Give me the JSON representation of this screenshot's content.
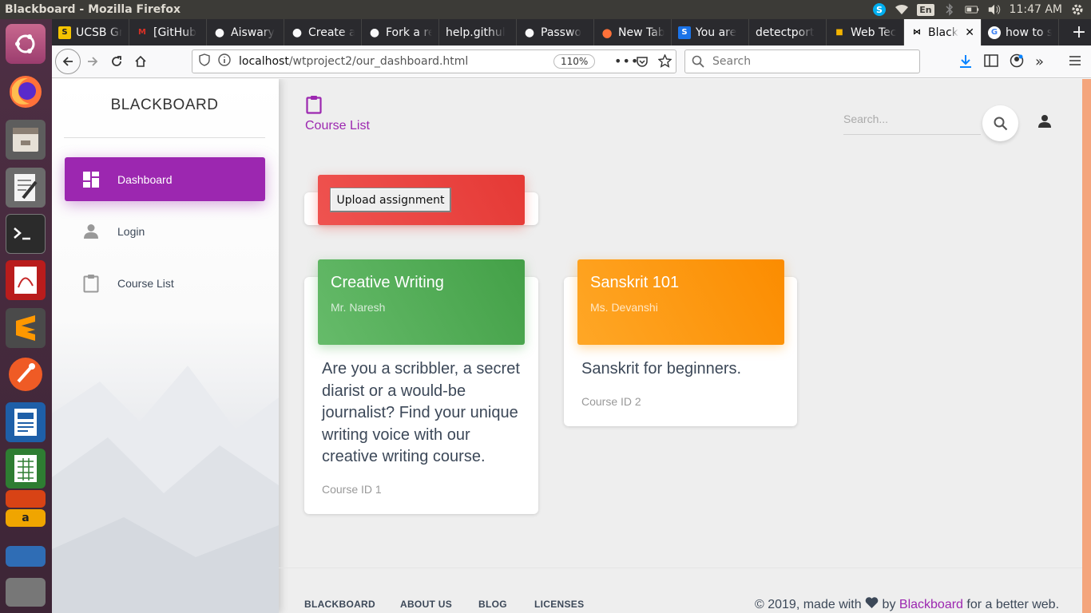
{
  "system": {
    "window_title": "Blackboard - Mozilla Firefox",
    "keyboard_layout": "En",
    "clock": "11:47 AM"
  },
  "launcher": {
    "items": [
      "ubuntu-dash",
      "firefox",
      "files",
      "text-editor",
      "terminal",
      "document-viewer",
      "sublime-text",
      "postman",
      "writer",
      "calc",
      "impress",
      "amazon",
      "system-monitor",
      "trash"
    ]
  },
  "browser": {
    "tabs": [
      {
        "label": "UCSB Gr",
        "icon": "ucsb-icon",
        "color": "#f5c400"
      },
      {
        "label": "[GitHub",
        "icon": "gmail-icon",
        "color": "#d93025"
      },
      {
        "label": "Aiswary",
        "icon": "github-icon",
        "color": "#ffffff"
      },
      {
        "label": "Create a",
        "icon": "github-icon",
        "color": "#ffffff"
      },
      {
        "label": "Fork a re",
        "icon": "github-icon",
        "color": "#ffffff"
      },
      {
        "label": "help.githul",
        "icon": "",
        "color": ""
      },
      {
        "label": "Passwo",
        "icon": "github-icon",
        "color": "#ffffff"
      },
      {
        "label": "New Tab",
        "icon": "firefox-icon",
        "color": "#ff7139"
      },
      {
        "label": "You are",
        "icon": "s-icon",
        "color": "#1a73e8"
      },
      {
        "label": "detectport",
        "icon": "",
        "color": ""
      },
      {
        "label": "Web Tec",
        "icon": "slides-icon",
        "color": "#f4b400"
      },
      {
        "label": "Black",
        "icon": "bow-icon",
        "color": "#000000",
        "active": true
      },
      {
        "label": "how to s",
        "icon": "google-icon",
        "color": "#4285f4"
      }
    ],
    "url_host": "localhost",
    "url_path": "/wtproject2/our_dashboard.html",
    "zoom": "110%",
    "search_placeholder": "Search"
  },
  "sidebar": {
    "brand": "BLACKBOARD",
    "items": [
      {
        "label": "Dashboard",
        "icon": "dashboard-icon",
        "active": true
      },
      {
        "label": "Login",
        "icon": "person-icon"
      },
      {
        "label": "Course List",
        "icon": "clipboard-icon"
      }
    ],
    "active_color": "#9c27b0"
  },
  "header": {
    "title": "Course List",
    "search_placeholder": "Search..."
  },
  "upload": {
    "button_label": "Upload assignment"
  },
  "courses": [
    {
      "title": "Creative Writing",
      "instructor": "Mr. Naresh",
      "description": "Are you a scribbler, a secret diarist or a would-be journalist? Find your unique writing voice with our creative writing course.",
      "course_id": "Course ID 1",
      "color": "#4caf50"
    },
    {
      "title": "Sanskrit 101",
      "instructor": "Ms. Devanshi",
      "description": "Sanskrit for beginners.",
      "course_id": "Course ID 2",
      "color": "#ff9800"
    }
  ],
  "footer": {
    "links": [
      "BLACKBOARD",
      "ABOUT US",
      "BLOG",
      "LICENSES"
    ],
    "copy_prefix": "© 2019, made with",
    "copy_by": "by",
    "copy_brand": "Blackboard",
    "copy_suffix": "for a better web."
  }
}
